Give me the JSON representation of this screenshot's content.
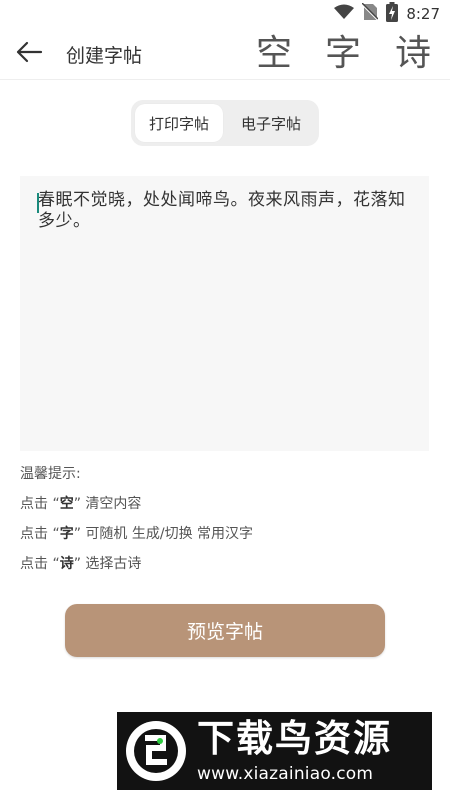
{
  "status_bar": {
    "time": "8:27"
  },
  "toolbar": {
    "title": "创建字帖",
    "btn_clear": "空",
    "btn_char": "字",
    "btn_poem": "诗"
  },
  "tabs": {
    "print": "打印字帖",
    "digital": "电子字帖"
  },
  "editor": {
    "text": "春眠不觉晓，处处闻啼鸟。夜来风雨声，花落知多少。"
  },
  "tips": {
    "title": "温馨提示:",
    "line1_prefix": "点击 “",
    "line1_key": "空",
    "line1_suffix": "” 清空内容",
    "line2_prefix": "点击 “",
    "line2_key": "字",
    "line2_suffix": "” 可随机 生成/切换 常用汉字",
    "line3_prefix": "点击 “",
    "line3_key": "诗",
    "line3_suffix": "” 选择古诗"
  },
  "preview_button": "预览字帖",
  "watermark": {
    "title": "下载鸟资源",
    "url": "www.xiazainiao.com"
  },
  "colors": {
    "accent": "#b89478",
    "caret": "#1a8a7c"
  }
}
